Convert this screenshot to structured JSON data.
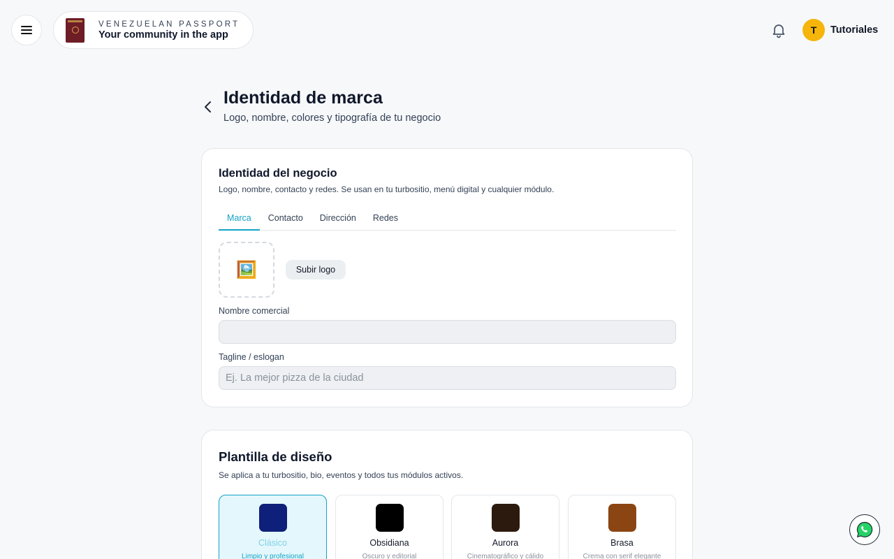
{
  "header": {
    "brand_top": "VENEZUELAN PASSPORT",
    "brand_bottom": "Your community in the app",
    "avatar_initial": "T",
    "user_name": "Tutoriales"
  },
  "page": {
    "title": "Identidad de marca",
    "subtitle": "Logo, nombre, colores y tipografía de tu negocio"
  },
  "identity": {
    "title": "Identidad del negocio",
    "description": "Logo, nombre, contacto y redes. Se usan en tu turbositio, menú digital y cualquier módulo.",
    "tabs": [
      "Marca",
      "Contacto",
      "Dirección",
      "Redes"
    ],
    "active_tab": "Marca",
    "logo_placeholder_icon": "🖼️",
    "upload_label": "Subir logo",
    "name_label": "Nombre comercial",
    "name_value": "",
    "tagline_label": "Tagline / eslogan",
    "tagline_placeholder": "Ej. La mejor pizza de la ciudad"
  },
  "templates": {
    "title": "Plantilla de diseño",
    "description": "Se aplica a tu turbositio, bio, eventos y todos tus módulos activos.",
    "items": [
      {
        "name": "Clásico",
        "desc": "Limpio y profesional",
        "color": "#0e2079",
        "selected": true
      },
      {
        "name": "Obsidiana",
        "desc": "Oscuro y editorial",
        "color": "#000000",
        "selected": false
      },
      {
        "name": "Aurora",
        "desc": "Cinematográfico y cálido",
        "color": "#2d1a0e",
        "selected": false
      },
      {
        "name": "Brasa",
        "desc": "Crema con serif elegante",
        "color": "#8b4513",
        "selected": false
      }
    ]
  },
  "colors": {
    "accent": "#14a3c7",
    "avatar": "#f5b50a"
  }
}
